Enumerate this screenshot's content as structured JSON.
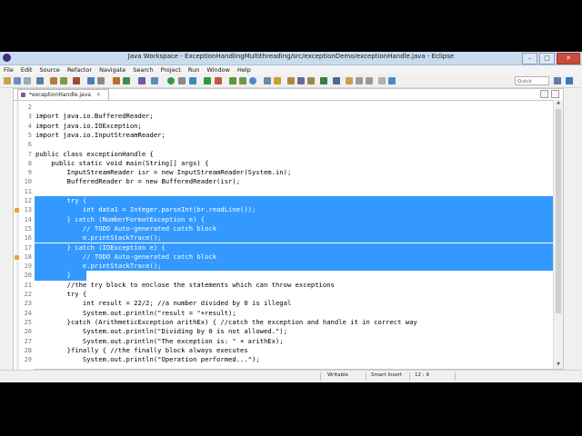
{
  "window": {
    "title": "Java Workspace - ExceptionHandlingMultithreading/src/exceptionDemo/exceptionHandle.java - Eclipse",
    "buttons": {
      "minimize": "–",
      "maximize": "□",
      "close": "✕"
    }
  },
  "menu": [
    "File",
    "Edit",
    "Source",
    "Refactor",
    "Navigate",
    "Search",
    "Project",
    "Run",
    "Window",
    "Help"
  ],
  "toolbar": {
    "quick_access": "Quick Access"
  },
  "editor": {
    "tab_label": "*exceptionHandle.java",
    "tab_close": "✕"
  },
  "code_lines": [
    {
      "n": "2",
      "t": ""
    },
    {
      "n": "3",
      "t": "import java.io.BufferedReader;"
    },
    {
      "n": "4",
      "t": "import java.io.IOException;"
    },
    {
      "n": "5",
      "t": "import java.io.InputStreamReader;"
    },
    {
      "n": "6",
      "t": ""
    },
    {
      "n": "7",
      "t": "public class exceptionHandle {"
    },
    {
      "n": "8",
      "t": "    public static void main(String[] args) {"
    },
    {
      "n": "9",
      "t": "        InputStreamReader isr = new InputStreamReader(System.in);"
    },
    {
      "n": "10",
      "t": "        BufferedReader br = new BufferedReader(isr);"
    },
    {
      "n": "11",
      "t": ""
    },
    {
      "n": "12",
      "t": "        try {"
    },
    {
      "n": "13",
      "t": "            int data1 = Integer.parseInt(br.readLine());"
    },
    {
      "n": "14",
      "t": "        } catch (NumberFormatException e) {"
    },
    {
      "n": "15",
      "t": "            // TODO Auto-generated catch block"
    },
    {
      "n": "16",
      "t": "            e.printStackTrace();"
    },
    {
      "n": "17",
      "t": "        } catch (IOException e) {"
    },
    {
      "n": "18",
      "t": "            // TODO Auto-generated catch block"
    },
    {
      "n": "19",
      "t": "            e.printStackTrace();"
    },
    {
      "n": "20",
      "t": "        }"
    },
    {
      "n": "21",
      "t": "        //the try block to enclose the statements which can throw exceptions"
    },
    {
      "n": "22",
      "t": "        try {"
    },
    {
      "n": "23",
      "t": "            int result = 22/2; //a number divided by 0 is illegal"
    },
    {
      "n": "24",
      "t": "            System.out.println(\"result = \"+result);"
    },
    {
      "n": "25",
      "t": "        }catch (ArithmeticException arithEx) { //catch the exception and handle it in correct way"
    },
    {
      "n": "26",
      "t": "            System.out.println(\"Dividing by 0 is not allowed.\");"
    },
    {
      "n": "27",
      "t": "            System.out.println(\"The exception is: \" + arithEx);"
    },
    {
      "n": "28",
      "t": "        }finally { //the finally block always executes"
    },
    {
      "n": "29",
      "t": "            System.out.println(\"Operation performed...\");"
    }
  ],
  "status": {
    "writable": "Writable",
    "insert_mode": "Smart Insert",
    "position": "12 : 9"
  }
}
